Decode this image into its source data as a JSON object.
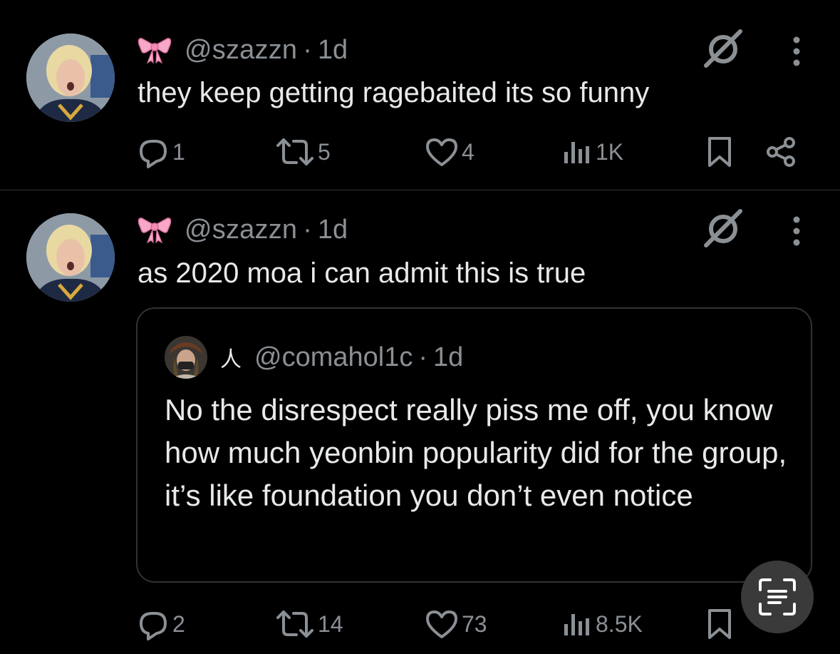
{
  "tweets": [
    {
      "handle": "@szazzn",
      "separator": "·",
      "time": "1d",
      "text": "they keep getting ragebaited its so funny",
      "actions": {
        "replies": "1",
        "retweets": "5",
        "likes": "4",
        "views": "1K"
      }
    },
    {
      "handle": "@szazzn",
      "separator": "·",
      "time": "1d",
      "text": "as 2020 moa i can admit this is true",
      "quote": {
        "symbol": "人",
        "handle": "@comahol1c",
        "separator": "·",
        "time": "1d",
        "text": "No the disrespect really piss me off, you know how much yeonbin popularity did for the group, it’s like foundation you don’t even notice"
      },
      "actions": {
        "replies": "2",
        "retweets": "14",
        "likes": "73",
        "views": "8.5K"
      }
    }
  ],
  "icons": {
    "bow": "pink-ribbon-bow-icon",
    "grok": "grok-slash-icon",
    "more": "vertical-ellipsis-icon",
    "reply": "reply-bubble-icon",
    "retweet": "retweet-icon",
    "like": "heart-icon",
    "views": "views-chart-icon",
    "bookmark": "bookmark-icon",
    "share": "share-icon",
    "scan": "live-text-scan-icon"
  },
  "colors": {
    "background": "#000000",
    "text": "#e7e9ea",
    "muted": "#8b9095",
    "bow": "#f7a8c8",
    "border": "#2f3336"
  }
}
